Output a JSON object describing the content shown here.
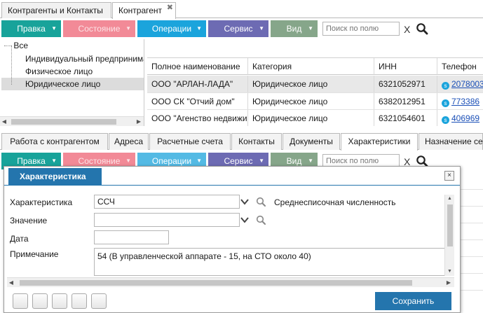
{
  "top_tabs": [
    {
      "label": "Контрагенты и Контакты"
    },
    {
      "label": "Контрагент"
    }
  ],
  "toolbar": {
    "edit": "Правка",
    "state": "Состояние",
    "operations": "Операции",
    "service": "Сервис",
    "view": "Вид",
    "search_placeholder": "Поиск по полю",
    "clear": "X"
  },
  "tree": {
    "root": "Все",
    "items": [
      "Индивидуальный предприниматель",
      "Физическое лицо",
      "Юридическое лицо"
    ],
    "selected": "Юридическое лицо"
  },
  "grid": {
    "columns": [
      "Полное наименование",
      "Категория",
      "ИНН",
      "Телефон"
    ],
    "rows": [
      {
        "name": "ООО \"АРЛАН-ЛАДА\"",
        "category": "Юридическое лицо",
        "inn": "6321052971",
        "phone": "2078003"
      },
      {
        "name": "ООО СК \"Отчий дом\"",
        "category": "Юридическое лицо",
        "inn": "6382012951",
        "phone": "773386"
      },
      {
        "name": "ООО \"Агенство недвижимости\"",
        "category": "Юридическое лицо",
        "inn": "6321054601",
        "phone": "406969"
      }
    ]
  },
  "bottom_tabs": [
    "Работа с контрагентом",
    "Адреса",
    "Расчетные счета",
    "Контакты",
    "Документы",
    "Характеристики",
    "Назначение сегментов"
  ],
  "bottom_active_tab": "Характеристики",
  "dialog": {
    "title": "Характеристика",
    "close": "×",
    "fields": {
      "characteristic_label": "Характеристика",
      "characteristic_value": "ССЧ",
      "characteristic_desc": "Среднесписочная численность",
      "value_label": "Значение",
      "value_value": "",
      "date_label": "Дата",
      "date_value": "",
      "note_label": "Примечание",
      "note_value": "54 (В управленческой аппарате - 15, на СТО около 40)"
    },
    "save": "Сохранить"
  },
  "colors": {
    "edit": "#18a39a",
    "state": "#f28a97",
    "operations": "#1ba4dc",
    "service": "#6d6bb3",
    "view": "#86a68a",
    "dialog_accent": "#2475ad"
  }
}
